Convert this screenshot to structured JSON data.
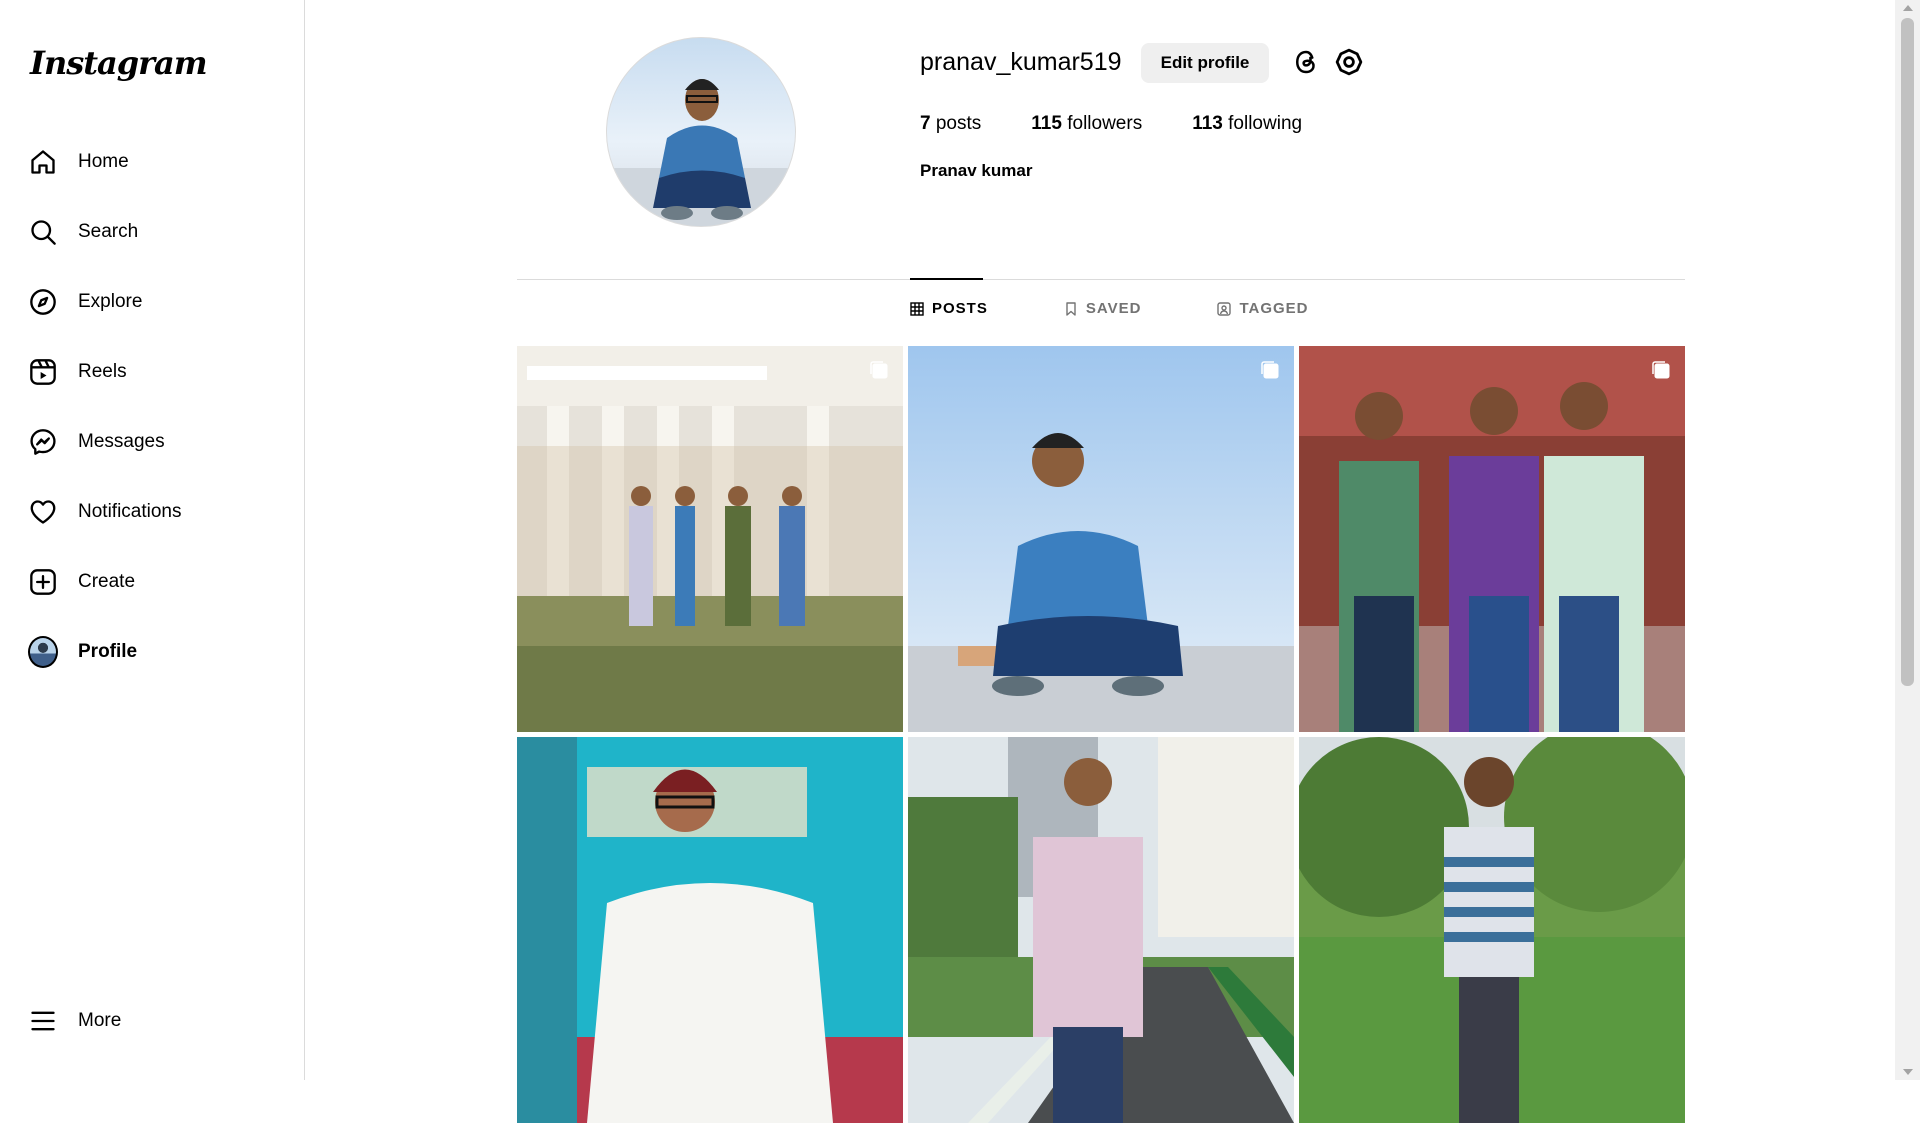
{
  "sidebar": {
    "logo": "Instagram",
    "items": [
      {
        "label": "Home",
        "icon": "home-icon"
      },
      {
        "label": "Search",
        "icon": "search-icon"
      },
      {
        "label": "Explore",
        "icon": "compass-icon"
      },
      {
        "label": "Reels",
        "icon": "reels-icon"
      },
      {
        "label": "Messages",
        "icon": "messenger-icon"
      },
      {
        "label": "Notifications",
        "icon": "heart-icon"
      },
      {
        "label": "Create",
        "icon": "plus-square-icon"
      },
      {
        "label": "Profile",
        "icon": "avatar"
      }
    ],
    "more_label": "More"
  },
  "profile": {
    "username": "pranav_kumar519",
    "edit_label": "Edit profile",
    "posts_count": "7",
    "posts_label": "posts",
    "followers_count": "115",
    "followers_label": "followers",
    "following_count": "113",
    "following_label": "following",
    "full_name": "Pranav kumar"
  },
  "tabs": [
    {
      "label": "POSTS",
      "icon": "grid-icon",
      "active": true
    },
    {
      "label": "SAVED",
      "icon": "bookmark-icon",
      "active": false
    },
    {
      "label": "TAGGED",
      "icon": "tag-person-icon",
      "active": false
    }
  ],
  "posts": [
    {
      "scene": "group of four men in front of white colonnaded building",
      "multi": true
    },
    {
      "scene": "man crouching on rooftop against blue sky",
      "multi": true
    },
    {
      "scene": "three men with crossed arms at night fair",
      "multi": true
    },
    {
      "scene": "man in white kurta and red cap in blue room",
      "multi": false
    },
    {
      "scene": "man in pink shirt standing on path with greenery",
      "multi": false
    },
    {
      "scene": "man in striped t-shirt standing among trees",
      "multi": false
    }
  ],
  "colors": {
    "border": "#dbdbdb",
    "button_bg": "#efefef",
    "muted_text": "#737373"
  }
}
